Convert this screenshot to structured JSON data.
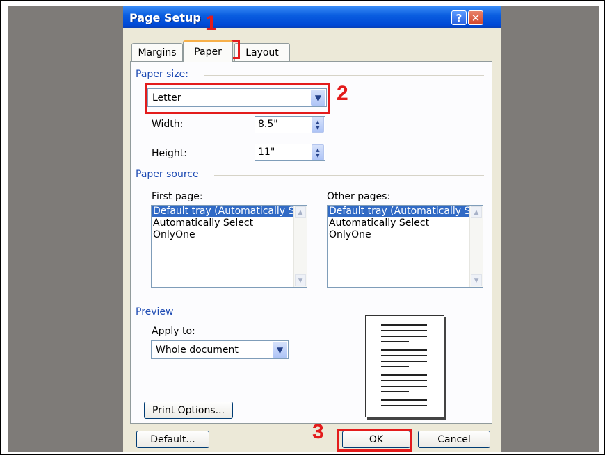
{
  "dialog": {
    "title": "Page Setup",
    "help_label": "?",
    "close_label": "✕"
  },
  "tabs": [
    {
      "label": "Margins"
    },
    {
      "label": "Paper",
      "active": true
    },
    {
      "label": "Layout"
    }
  ],
  "paper_size": {
    "section_label": "Paper size:",
    "selected": "Letter",
    "width_label": "Width:",
    "width_value": "8.5\"",
    "height_label": "Height:",
    "height_value": "11\""
  },
  "paper_source": {
    "section_label": "Paper source",
    "first_page_label": "First page:",
    "other_pages_label": "Other pages:",
    "first_page_items": [
      "Default tray (Automatically S",
      "Automatically Select",
      "OnlyOne"
    ],
    "other_pages_items": [
      "Default tray (Automatically S",
      "Automatically Select",
      "OnlyOne"
    ],
    "selected_index": 0
  },
  "preview": {
    "section_label": "Preview",
    "apply_to_label": "Apply to:",
    "apply_to_value": "Whole document"
  },
  "buttons": {
    "print_options": "Print Options...",
    "default": "Default...",
    "ok": "OK",
    "cancel": "Cancel"
  },
  "callouts": [
    "1",
    "2",
    "3"
  ],
  "colors": {
    "callout": "#e31c1c",
    "titlebar": "#0a5ee0",
    "selection": "#316ac5",
    "section_text": "#1e4bb3"
  }
}
